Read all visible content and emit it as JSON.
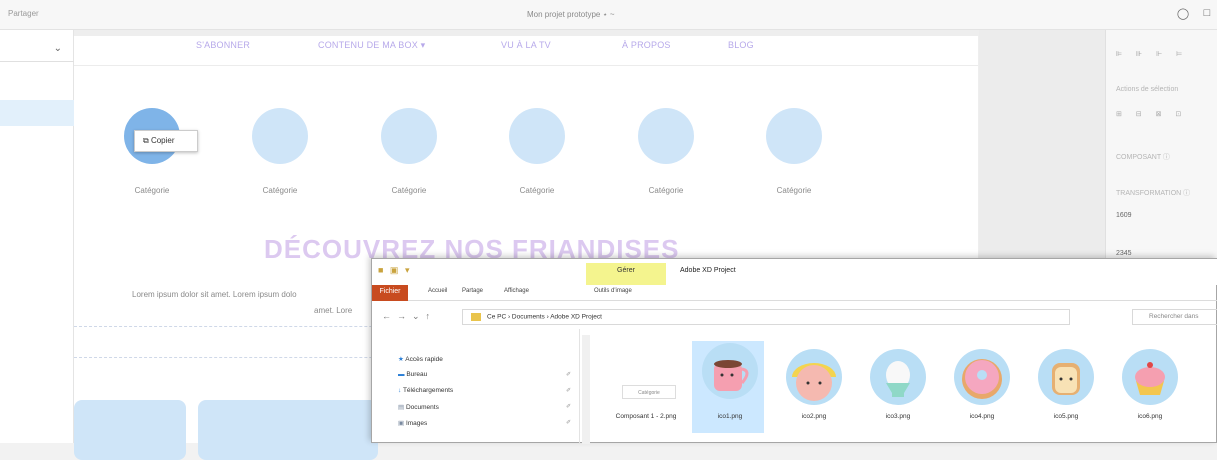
{
  "titlebar": {
    "left_text": "Partager",
    "center_text": "Mon projet prototype ⋆ ~"
  },
  "nav": {
    "items": [
      "S'ABONNER",
      "CONTENU DE MA BOX ▾",
      "VU À LA TV",
      "À PROPOS",
      "BLOG"
    ]
  },
  "categories": {
    "labels": [
      "Catégorie",
      "Catégorie",
      "Catégorie",
      "Catégorie",
      "Catégorie",
      "Catégorie"
    ]
  },
  "context_menu": {
    "copy_label": "Copier"
  },
  "page": {
    "headline": "DÉCOUVREZ NOS FRIANDISES",
    "lorem_line1": "Lorem ipsum dolor sit amet. Lorem ipsum dolo",
    "lorem_line2": "amet. Lore"
  },
  "properties_panel": {
    "rows": [
      "Actions de sélection",
      "COMPOSANT ⓘ",
      "TRANSFORMATION ⓘ",
      "1609",
      "2345"
    ]
  },
  "explorer": {
    "manage_tab": "Gérer",
    "window_title": "Adobe XD Project",
    "ribbon": {
      "file": "Fichier",
      "tabs": [
        "Accueil",
        "Partage",
        "Affichage",
        "Outils d'image"
      ]
    },
    "address": {
      "path": "Ce PC  ›  Documents  ›  Adobe XD Project",
      "search_placeholder": "Rechercher dans"
    },
    "nav_items": [
      "Accès rapide",
      "Bureau",
      "Téléchargements",
      "Documents",
      "Images"
    ],
    "files": [
      {
        "name": "Composant 1 - 2.png",
        "thumb_label": "Catégorie"
      },
      {
        "name": "ico1.png"
      },
      {
        "name": "ico2.png"
      },
      {
        "name": "ico3.png"
      },
      {
        "name": "ico4.png"
      },
      {
        "name": "ico5.png"
      },
      {
        "name": "ico6.png"
      }
    ]
  },
  "colors": {
    "nav_text": "#b7a9ea",
    "category_circle": "#cfe5f8",
    "headline": "#dcc9f0",
    "file_menu": "#c84b1f",
    "manage_tab": "#f4f48e",
    "selection": "#cce8ff"
  }
}
